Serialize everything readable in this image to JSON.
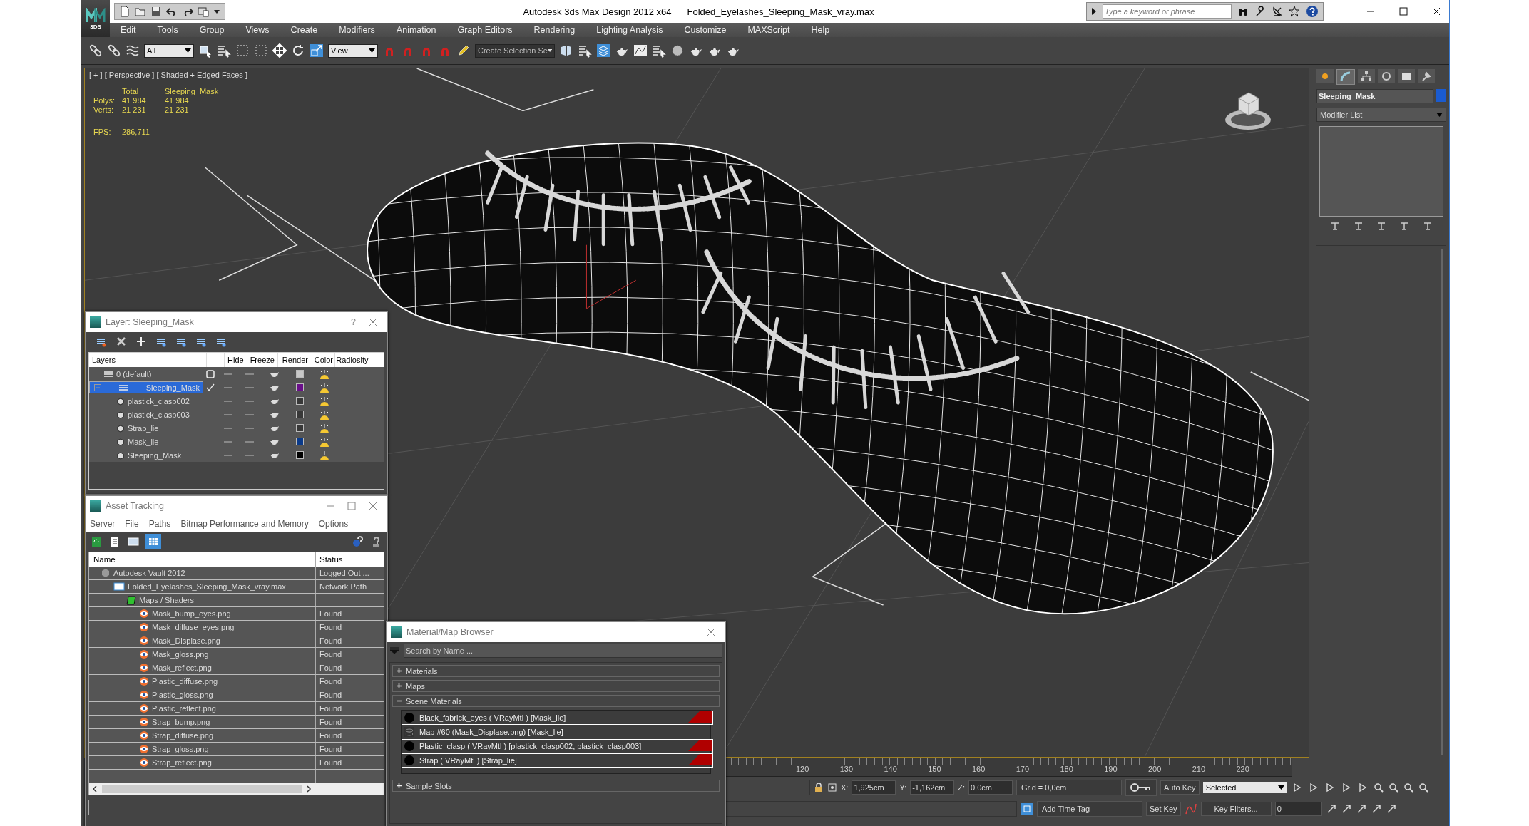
{
  "window": {
    "app_title": "Autodesk 3ds Max Design 2012 x64",
    "file_title": "Folded_Eyelashes_Sleeping_Mask_vray.max",
    "search_placeholder": "Type a keyword or phrase",
    "logo_caption": "3DS"
  },
  "menu": [
    "Edit",
    "Tools",
    "Group",
    "Views",
    "Create",
    "Modifiers",
    "Animation",
    "Graph Editors",
    "Rendering",
    "Lighting Analysis",
    "Customize",
    "MAXScript",
    "Help"
  ],
  "toolbar": {
    "selection_filter": "All",
    "reference_coord": "View",
    "named_selection": "Create Selection Se"
  },
  "viewport": {
    "label": "[ + ] [ Perspective ] [ Shaded + Edged Faces ]",
    "stats_header": [
      "Total",
      "Sleeping_Mask"
    ],
    "stats": [
      {
        "label": "Polys:",
        "values": [
          "41 984",
          "41 984"
        ]
      },
      {
        "label": "Verts:",
        "values": [
          "21 231",
          "21 231"
        ]
      }
    ],
    "fps_label": "FPS:",
    "fps": "286,711"
  },
  "command_panel": {
    "tabs": [
      {
        "selected": false
      },
      {
        "selected": true
      },
      {
        "selected": false
      },
      {
        "selected": false
      },
      {
        "selected": false
      },
      {
        "selected": false
      }
    ],
    "object_name": "Sleeping_Mask",
    "color": "#1a5bd0",
    "modifier_list": "Modifier List"
  },
  "layer_window": {
    "title": "Layer: Sleeping_Mask",
    "help": "?",
    "columns": [
      "Layers",
      "Hide",
      "Freeze",
      "Render",
      "Color",
      "Radiosity"
    ],
    "layers": [
      {
        "name": "0 (default)",
        "selected": false,
        "current": false,
        "color": "#c8c8c8"
      },
      {
        "name": "Sleeping_Mask",
        "selected": true,
        "current": true,
        "expanded": true,
        "color": "#6a0f8a",
        "children": [
          {
            "name": "plastick_clasp002",
            "color": "#383838"
          },
          {
            "name": "plastick_clasp003",
            "color": "#383838"
          },
          {
            "name": "Strap_lie",
            "color": "#383838"
          },
          {
            "name": "Mask_lie",
            "color": "#0a3a8a"
          },
          {
            "name": "Sleeping_Mask",
            "color": "#000000"
          }
        ]
      }
    ]
  },
  "asset_window": {
    "title": "Asset Tracking",
    "menu": [
      "Server",
      "File",
      "Paths",
      "Bitmap Performance and Memory",
      "Options"
    ],
    "columns": [
      "Name",
      "Status"
    ],
    "rows": [
      {
        "kind": "vault",
        "name": "Autodesk Vault 2012",
        "status": "Logged Out ...",
        "children": [
          {
            "kind": "scene",
            "name": "Folded_Eyelashes_Sleeping_Mask_vray.max",
            "status": "Network Path",
            "children": [
              {
                "kind": "folder",
                "name": "Maps / Shaders",
                "children": [
                  {
                    "kind": "bitmap",
                    "name": "Mask_bump_eyes.png",
                    "status": "Found"
                  },
                  {
                    "kind": "bitmap",
                    "name": "Mask_diffuse_eyes.png",
                    "status": "Found"
                  },
                  {
                    "kind": "bitmap",
                    "name": "Mask_Displase.png",
                    "status": "Found"
                  },
                  {
                    "kind": "bitmap",
                    "name": "Mask_gloss.png",
                    "status": "Found"
                  },
                  {
                    "kind": "bitmap",
                    "name": "Mask_reflect.png",
                    "status": "Found"
                  },
                  {
                    "kind": "bitmap",
                    "name": "Plastic_diffuse.png",
                    "status": "Found"
                  },
                  {
                    "kind": "bitmap",
                    "name": "Plastic_gloss.png",
                    "status": "Found"
                  },
                  {
                    "kind": "bitmap",
                    "name": "Plastic_reflect.png",
                    "status": "Found"
                  },
                  {
                    "kind": "bitmap",
                    "name": "Strap_bump.png",
                    "status": "Found"
                  },
                  {
                    "kind": "bitmap",
                    "name": "Strap_diffuse.png",
                    "status": "Found"
                  },
                  {
                    "kind": "bitmap",
                    "name": "Strap_gloss.png",
                    "status": "Found"
                  },
                  {
                    "kind": "bitmap",
                    "name": "Strap_reflect.png",
                    "status": "Found"
                  }
                ]
              }
            ]
          }
        ]
      }
    ]
  },
  "material_browser": {
    "title": "Material/Map Browser",
    "search_placeholder": "Search by Name ...",
    "sections": [
      {
        "label": "Materials",
        "expanded": false
      },
      {
        "label": "Maps",
        "expanded": false
      },
      {
        "label": "Scene Materials",
        "expanded": true,
        "items": [
          {
            "kind": "material",
            "name": "Black_fabrick_eyes  ( VRayMtl )  [Mask_lie]",
            "in_scene": true
          },
          {
            "kind": "map",
            "name": "Map #60 (Mask_Displase.png) [Mask_lie]",
            "in_scene": false
          },
          {
            "kind": "material",
            "name": "Plastic_clasp  ( VRayMtl )  [plastick_clasp002, plastick_clasp003]",
            "in_scene": true
          },
          {
            "kind": "material",
            "name": "Strap  ( VRayMtl )  [Strap_lie]",
            "in_scene": true
          }
        ]
      },
      {
        "label": "Sample Slots",
        "expanded": false
      }
    ]
  },
  "timeline": {
    "ticks": [
      "120",
      "130",
      "140",
      "150",
      "160",
      "170",
      "180",
      "190",
      "200",
      "210",
      "220"
    ]
  },
  "status_bar": {
    "x_label": "X:",
    "x": "1,925cm",
    "y_label": "Y:",
    "y": "-1,162cm",
    "z_label": "Z:",
    "z": "0,0cm",
    "grid": "Grid = 0,0cm",
    "add_time_tag": "Add Time Tag",
    "auto_key": "Auto Key",
    "key_mode": "Selected",
    "set_key": "Set Key",
    "key_filters": "Key Filters...",
    "frame": "0"
  }
}
